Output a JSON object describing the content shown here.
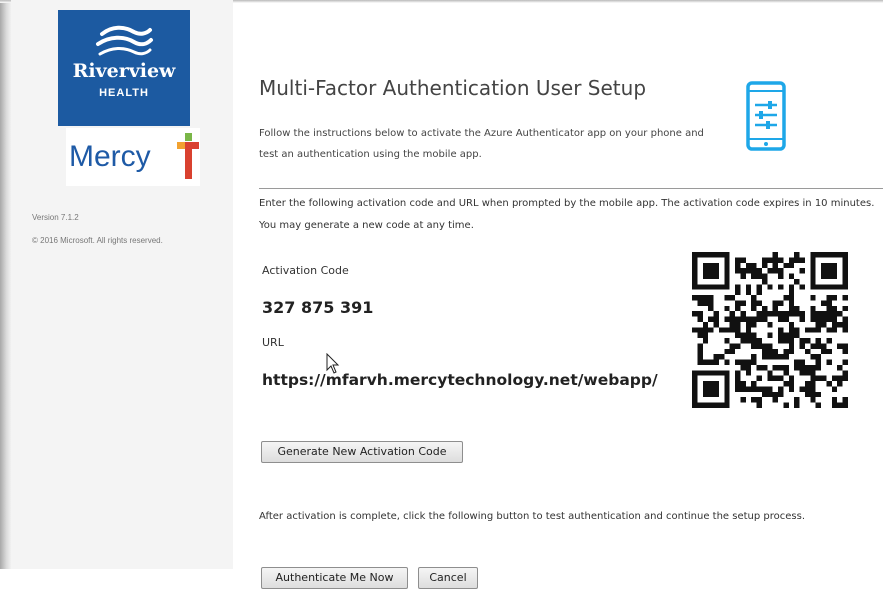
{
  "sidebar": {
    "brand_riverview": "Riverview",
    "brand_health": "HEALTH",
    "brand_mercy": "Mercy",
    "version": "Version 7.1.2",
    "copyright": "© 2016 Microsoft. All rights reserved.",
    "background_color": "#f4f4f4",
    "riverview_color": "#1c5aa1"
  },
  "header": {
    "title": "Multi-Factor Authentication User Setup",
    "intro": "Follow the instructions below to activate the Azure Authenticator app on your phone and test an authentication using the mobile app.",
    "icon": "mobile-phone-settings-icon"
  },
  "main": {
    "instructions": "Enter the following activation code and URL when prompted by the mobile app. The activation code expires in 10 minutes. You may generate a new code at any time.",
    "activation_code_label": "Activation Code",
    "activation_code": "327 875 391",
    "url_label": "URL",
    "url_value": "https://mfarvh.mercytechnology.net/webapp/",
    "qr_icon": "qr-code",
    "generate_button": "Generate New Activation Code",
    "after_text": "After activation is complete, click the following button to test authentication and continue the setup process.",
    "authenticate_button": "Authenticate Me Now",
    "cancel_button": "Cancel"
  },
  "colors": {
    "accent_blue": "#1ea7e8",
    "mercy_blue": "#1e5aa6",
    "mercy_cross_green": "#7ab648",
    "mercy_cross_red": "#d9412f",
    "mercy_cross_orange": "#f2a230"
  }
}
